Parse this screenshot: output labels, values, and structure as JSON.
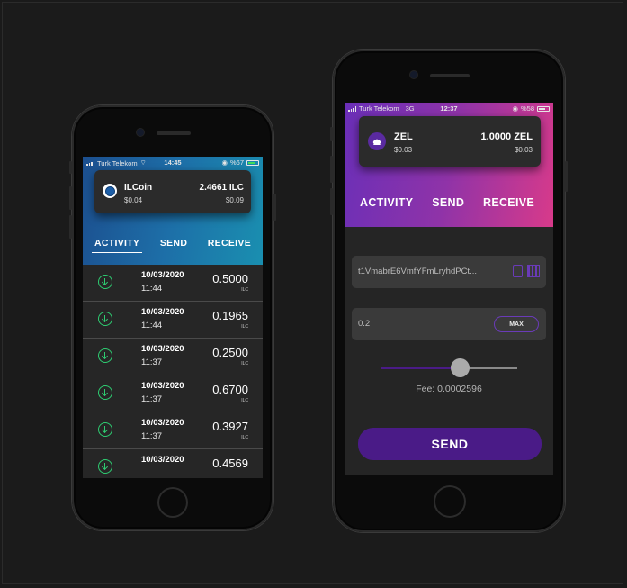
{
  "left_phone": {
    "status": {
      "carrier": "Turk Telekom",
      "time": "14:45",
      "battery": "%67"
    },
    "wallet": {
      "name": "ILCoin",
      "fiat": "$0.04",
      "amount": "2.4661 ILC",
      "fiat_total": "$0.09"
    },
    "tabs": [
      "ACTIVITY",
      "SEND",
      "RECEIVE"
    ],
    "active_tab": "ACTIVITY",
    "transactions": [
      {
        "date": "10/03/2020",
        "time": "11:44",
        "value": "0.5000",
        "unit": "ILC"
      },
      {
        "date": "10/03/2020",
        "time": "11:44",
        "value": "0.1965",
        "unit": "ILC"
      },
      {
        "date": "10/03/2020",
        "time": "11:37",
        "value": "0.2500",
        "unit": "ILC"
      },
      {
        "date": "10/03/2020",
        "time": "11:37",
        "value": "0.6700",
        "unit": "ILC"
      },
      {
        "date": "10/03/2020",
        "time": "11:37",
        "value": "0.3927",
        "unit": "ILC"
      },
      {
        "date": "10/03/2020",
        "time": "",
        "value": "0.4569",
        "unit": ""
      }
    ]
  },
  "right_phone": {
    "status": {
      "carrier": "Turk Telekom",
      "network": "3G",
      "time": "12:37",
      "battery": "%58"
    },
    "wallet": {
      "name": "ZEL",
      "fiat": "$0.03",
      "amount": "1.0000 ZEL",
      "fiat_total": "$0.03"
    },
    "tabs": [
      "ACTIVITY",
      "SEND",
      "RECEIVE"
    ],
    "active_tab": "SEND",
    "send": {
      "address": "t1VmabrE6VmfYFmLryhdPCt...",
      "amount": "0.2",
      "max_label": "MAX",
      "fee_slider_level": 0.45,
      "fee": "Fee: 0.0002596",
      "send_label": "SEND"
    }
  },
  "colors": {
    "ilc_gradient": [
      "#1c4f8f",
      "#1a8fb0"
    ],
    "zel_gradient": [
      "#6a2fb8",
      "#d83a8a"
    ],
    "accent_green": "#2ecc71",
    "send_button": "#4a1b87"
  }
}
